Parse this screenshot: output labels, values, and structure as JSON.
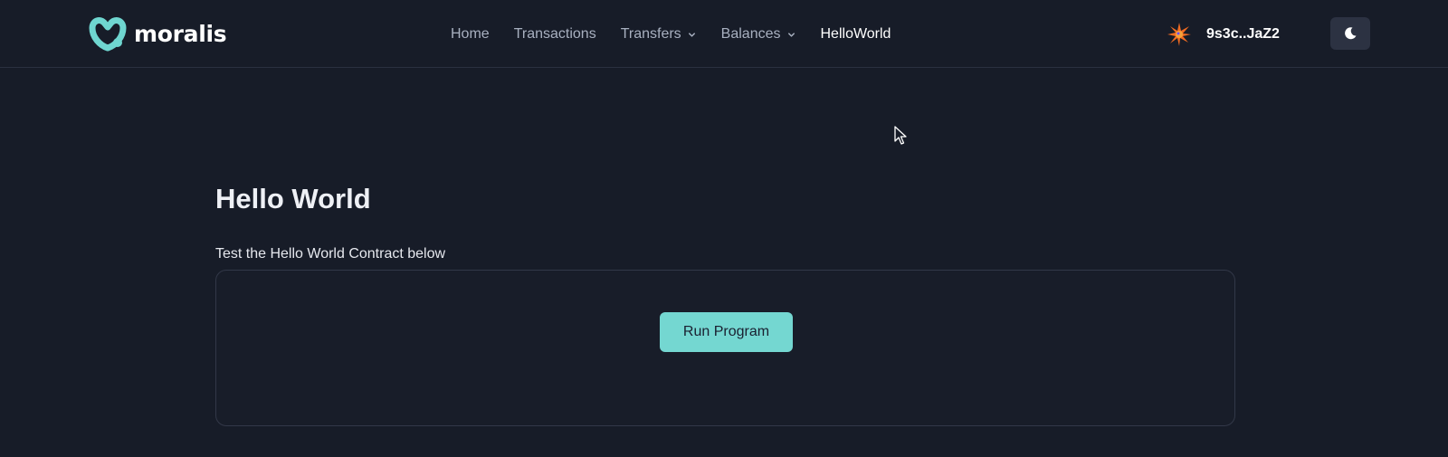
{
  "brand": {
    "name": "moralis",
    "logo_color": "#6fd6d0"
  },
  "nav": {
    "items": [
      {
        "label": "Home",
        "dropdown": false,
        "active": false
      },
      {
        "label": "Transactions",
        "dropdown": false,
        "active": false
      },
      {
        "label": "Transfers",
        "dropdown": true,
        "active": false
      },
      {
        "label": "Balances",
        "dropdown": true,
        "active": false
      },
      {
        "label": "HelloWorld",
        "dropdown": false,
        "active": true
      }
    ]
  },
  "wallet": {
    "address": "9s3c..JaZ2",
    "icon": "starburst-avatar-icon"
  },
  "theme_toggle": {
    "icon": "moon-icon"
  },
  "main": {
    "title": "Hello World",
    "subtitle": "Test the Hello World Contract below",
    "run_button_label": "Run Program"
  },
  "colors": {
    "background": "#171c28",
    "accent": "#74d7d1",
    "nav_text": "#a8b0c0",
    "nav_active": "#ffffff"
  }
}
